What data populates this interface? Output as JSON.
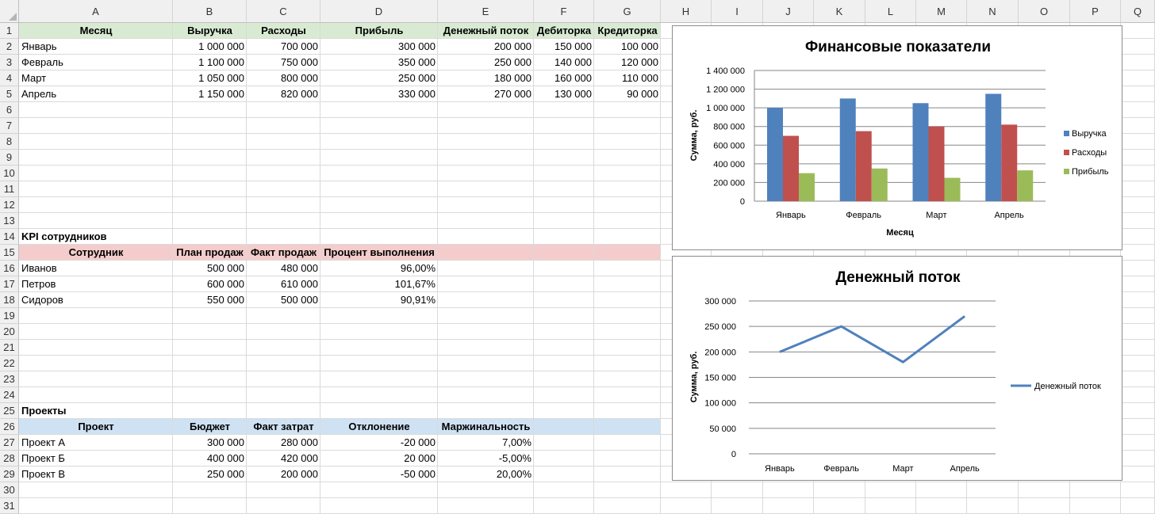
{
  "columns": [
    "A",
    "B",
    "C",
    "D",
    "E",
    "F",
    "G",
    "H",
    "I",
    "J",
    "K",
    "L",
    "M",
    "N",
    "O",
    "P",
    "Q"
  ],
  "row_numbers": [
    "1",
    "2",
    "3",
    "4",
    "5",
    "6",
    "7",
    "8",
    "9",
    "10",
    "11",
    "12",
    "13",
    "14",
    "15",
    "16",
    "17",
    "18",
    "19",
    "20",
    "21",
    "22",
    "23",
    "24",
    "25",
    "26",
    "27",
    "28",
    "29",
    "30",
    "31"
  ],
  "colors": {
    "header_green": "#d9ead3",
    "header_red": "#f4cccc",
    "header_blue": "#cfe2f3",
    "revenue": "#4f81bd",
    "expenses": "#c0504d",
    "profit": "#9bbb59",
    "cashflow_line": "#4f81bd"
  },
  "finance": {
    "headers": [
      "Месяц",
      "Выручка",
      "Расходы",
      "Прибыль",
      "Денежный поток",
      "Дебиторка",
      "Кредиторка"
    ],
    "rows": [
      [
        "Январь",
        "1 000 000",
        "700 000",
        "300 000",
        "200 000",
        "150 000",
        "100 000"
      ],
      [
        "Февраль",
        "1 100 000",
        "750 000",
        "350 000",
        "250 000",
        "140 000",
        "120 000"
      ],
      [
        "Март",
        "1 050 000",
        "800 000",
        "250 000",
        "180 000",
        "160 000",
        "110 000"
      ],
      [
        "Апрель",
        "1 150 000",
        "820 000",
        "330 000",
        "270 000",
        "130 000",
        "90 000"
      ]
    ]
  },
  "kpi": {
    "title": "KPI сотрудников",
    "headers": [
      "Сотрудник",
      "План продаж",
      "Факт продаж",
      "Процент выполнения"
    ],
    "rows": [
      [
        "Иванов",
        "500 000",
        "480 000",
        "96,00%"
      ],
      [
        "Петров",
        "600 000",
        "610 000",
        "101,67%"
      ],
      [
        "Сидоров",
        "550 000",
        "500 000",
        "90,91%"
      ]
    ]
  },
  "projects": {
    "title": "Проекты",
    "headers": [
      "Проект",
      "Бюджет",
      "Факт затрат",
      "Отклонение",
      "Маржинальность"
    ],
    "rows": [
      [
        "Проект А",
        "300 000",
        "280 000",
        "-20 000",
        "7,00%"
      ],
      [
        "Проект Б",
        "400 000",
        "420 000",
        "20 000",
        "-5,00%"
      ],
      [
        "Проект В",
        "250 000",
        "200 000",
        "-50 000",
        "20,00%"
      ]
    ]
  },
  "chart_data": [
    {
      "type": "bar",
      "title": "Финансовые показатели",
      "xlabel": "Месяц",
      "ylabel": "Сумма, руб.",
      "categories": [
        "Январь",
        "Февраль",
        "Март",
        "Апрель"
      ],
      "series": [
        {
          "name": "Выручка",
          "values": [
            1000000,
            1100000,
            1050000,
            1150000
          ]
        },
        {
          "name": "Расходы",
          "values": [
            700000,
            750000,
            800000,
            820000
          ]
        },
        {
          "name": "Прибыль",
          "values": [
            300000,
            350000,
            250000,
            330000
          ]
        }
      ],
      "ylim": [
        0,
        1400000
      ],
      "yticks": [
        "0",
        "200 000",
        "400 000",
        "600 000",
        "800 000",
        "1 000 000",
        "1 200 000",
        "1 400 000"
      ],
      "grid": true,
      "legend": "right"
    },
    {
      "type": "line",
      "title": "Денежный поток",
      "xlabel": "",
      "ylabel": "Сумма, руб.",
      "categories": [
        "Январь",
        "Февраль",
        "Март",
        "Апрель"
      ],
      "series": [
        {
          "name": "Денежный поток",
          "values": [
            200000,
            250000,
            180000,
            270000
          ]
        }
      ],
      "ylim": [
        0,
        300000
      ],
      "yticks": [
        "0",
        "50 000",
        "100 000",
        "150 000",
        "200 000",
        "250 000",
        "300 000"
      ],
      "grid": true,
      "legend": "right"
    }
  ]
}
